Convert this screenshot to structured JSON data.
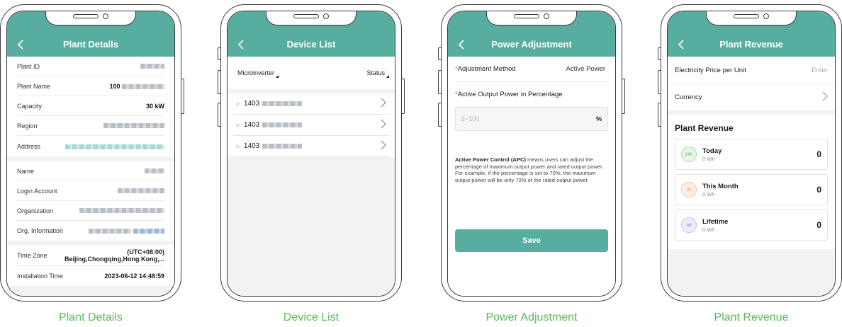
{
  "colors": {
    "header": "#58ada1",
    "caption": "#5cb85c"
  },
  "screens": {
    "plant_details": {
      "title": "Plant Details",
      "caption": "Plant Details",
      "rows_a": [
        {
          "label": "Plant ID",
          "value": ""
        },
        {
          "label": "Plant Name",
          "value": "100"
        },
        {
          "label": "Capacity",
          "value": "30 kW"
        },
        {
          "label": "Region",
          "value": ""
        },
        {
          "label": "Address",
          "value": ""
        }
      ],
      "rows_b": [
        {
          "label": "Name",
          "value": ""
        },
        {
          "label": "Login Account",
          "value": ""
        },
        {
          "label": "Organization",
          "value": ""
        },
        {
          "label": "Org. Information",
          "value": ""
        }
      ],
      "time_zone": {
        "label": "Time Zone",
        "line1": "(UTC+08:00)",
        "line2": "Beijing,Chongqing,Hong Kong,..."
      },
      "install": {
        "label": "Installation Time",
        "value": "2023-06-12 14:48:59"
      }
    },
    "device_list": {
      "title": "Device List",
      "caption": "Device List",
      "filter_type": "Microinverter",
      "filter_status": "Status",
      "devices": [
        "1403",
        "1403",
        "1403"
      ]
    },
    "power_adjustment": {
      "title": "Power Adjustment",
      "caption": "Power Adjustment",
      "method_label": "Adjustment Method",
      "method_value": "Active Power",
      "required_mark": "*",
      "output_label": "Active Output Power in Percentage",
      "input_placeholder": "2~100",
      "input_unit": "%",
      "desc_bold": "Active Power Control (APC)",
      "desc_rest": " means users can adjust the percentage of maximum output power and rated output power. For example, if the percentage is set to 70%, the maximum output power will be only 70% of the rated output power.",
      "save_label": "Save"
    },
    "plant_revenue": {
      "title": "Plant Revenue",
      "caption": "Plant Revenue",
      "price_label": "Electricity Price per Unit",
      "price_placeholder": "Enter",
      "currency_label": "Currency",
      "section_title": "Plant Revenue",
      "items": [
        {
          "name": "Today",
          "sub": "0 Wh",
          "value": "0",
          "icon": "24h"
        },
        {
          "name": "This Month",
          "sub": "0 Wh",
          "value": "0",
          "icon": "31"
        },
        {
          "name": "Lifetime",
          "sub": "0 Wh",
          "value": "0",
          "icon": "All"
        }
      ]
    }
  }
}
